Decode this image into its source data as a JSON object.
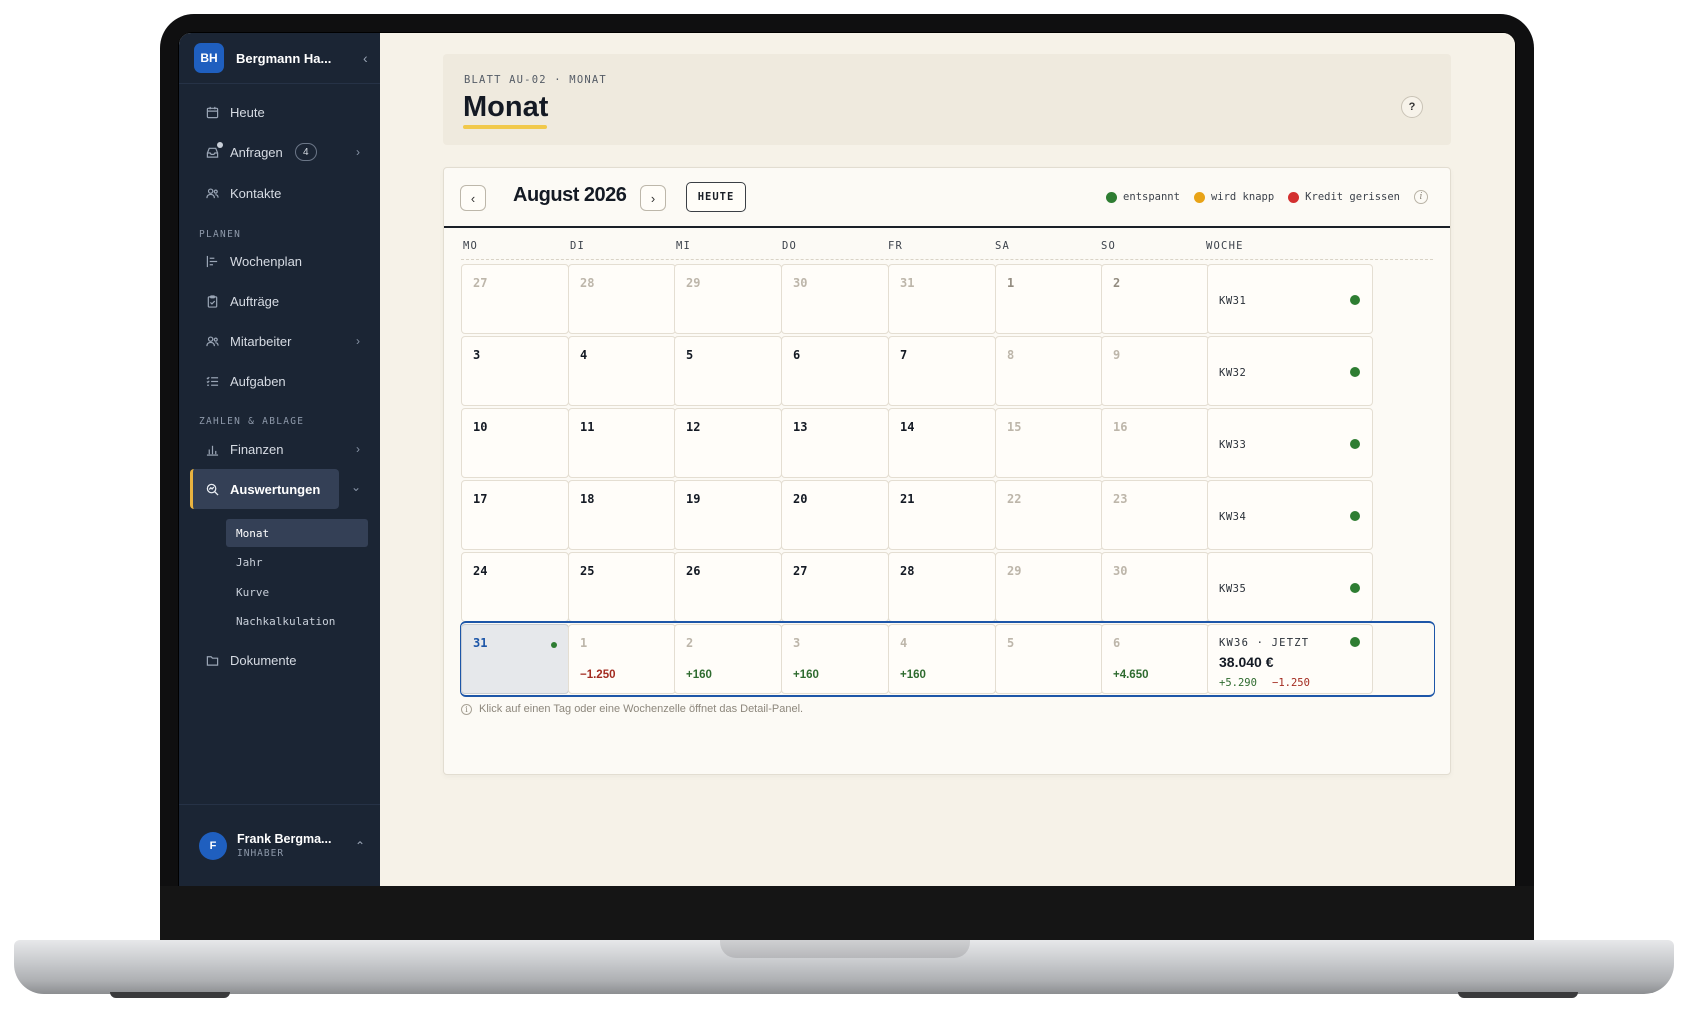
{
  "workspace": {
    "initials": "BH",
    "name": "Bergmann Ha...",
    "toggle": "‹"
  },
  "nav": {
    "heute": "Heute",
    "anfragen": "Anfragen",
    "anfragen_badge": "4",
    "kontakte": "Kontakte",
    "section_planen": "PLANEN",
    "wochenplan": "Wochenplan",
    "auftraege": "Aufträge",
    "mitarbeiter": "Mitarbeiter",
    "aufgaben": "Aufgaben",
    "section_zahlen": "ZAHLEN & ABLAGE",
    "finanzen": "Finanzen",
    "auswertungen": "Auswertungen",
    "sub": [
      "Monat",
      "Jahr",
      "Kurve",
      "Nachkalkulation"
    ],
    "dokumente": "Dokumente"
  },
  "user": {
    "initial": "F",
    "name": "Frank Bergma...",
    "role": "INHABER"
  },
  "header": {
    "breadcrumb": "BLATT AU-02 · MONAT",
    "title": "Monat",
    "help": "?"
  },
  "toolbar": {
    "month": "August 2026",
    "today_label": "HEUTE"
  },
  "legend": [
    {
      "label": "entspannt",
      "color": "#2e7d32"
    },
    {
      "label": "wird knapp",
      "color": "#e8a317"
    },
    {
      "label": "Kredit gerissen",
      "color": "#d32f2f"
    }
  ],
  "weekdays": [
    "MO",
    "DI",
    "MI",
    "DO",
    "FR",
    "SA",
    "SO",
    "WOCHE"
  ],
  "weeks": [
    {
      "days": [
        {
          "n": "27",
          "s": "out"
        },
        {
          "n": "28",
          "s": "out"
        },
        {
          "n": "29",
          "s": "out"
        },
        {
          "n": "30",
          "s": "out"
        },
        {
          "n": "31",
          "s": "out"
        },
        {
          "n": "1",
          "s": "we"
        },
        {
          "n": "2",
          "s": "we"
        }
      ],
      "kw": "KW31",
      "status": "#2e7d32"
    },
    {
      "days": [
        {
          "n": "3"
        },
        {
          "n": "4"
        },
        {
          "n": "5"
        },
        {
          "n": "6"
        },
        {
          "n": "7"
        },
        {
          "n": "8",
          "s": "out"
        },
        {
          "n": "9",
          "s": "out"
        }
      ],
      "kw": "KW32",
      "status": "#2e7d32"
    },
    {
      "days": [
        {
          "n": "10"
        },
        {
          "n": "11"
        },
        {
          "n": "12"
        },
        {
          "n": "13"
        },
        {
          "n": "14"
        },
        {
          "n": "15",
          "s": "out"
        },
        {
          "n": "16",
          "s": "out"
        }
      ],
      "kw": "KW33",
      "status": "#2e7d32"
    },
    {
      "days": [
        {
          "n": "17"
        },
        {
          "n": "18"
        },
        {
          "n": "19"
        },
        {
          "n": "20"
        },
        {
          "n": "21"
        },
        {
          "n": "22",
          "s": "out"
        },
        {
          "n": "23",
          "s": "out"
        }
      ],
      "kw": "KW34",
      "status": "#2e7d32"
    },
    {
      "days": [
        {
          "n": "24"
        },
        {
          "n": "25"
        },
        {
          "n": "26"
        },
        {
          "n": "27"
        },
        {
          "n": "28"
        },
        {
          "n": "29",
          "s": "out"
        },
        {
          "n": "30",
          "s": "out"
        }
      ],
      "kw": "KW35",
      "status": "#2e7d32"
    },
    {
      "days": [
        {
          "n": "31",
          "s": "today"
        },
        {
          "n": "1",
          "s": "out",
          "amt": "−1.250",
          "t": "neg"
        },
        {
          "n": "2",
          "s": "out",
          "amt": "+160",
          "t": "pos"
        },
        {
          "n": "3",
          "s": "out",
          "amt": "+160",
          "t": "pos"
        },
        {
          "n": "4",
          "s": "out",
          "amt": "+160",
          "t": "pos"
        },
        {
          "n": "5",
          "s": "out"
        },
        {
          "n": "6",
          "s": "out",
          "amt": "+4.650",
          "t": "pos"
        }
      ],
      "kw": "KW36 · JETZT",
      "status": "#2e7d32",
      "current": true,
      "total": "38.040 €",
      "inc": "+5.290",
      "dec": "−1.250"
    }
  ],
  "hint": "Klick auf einen Tag oder eine Wochenzelle öffnet das Detail-Panel.",
  "hint_icon": "i"
}
